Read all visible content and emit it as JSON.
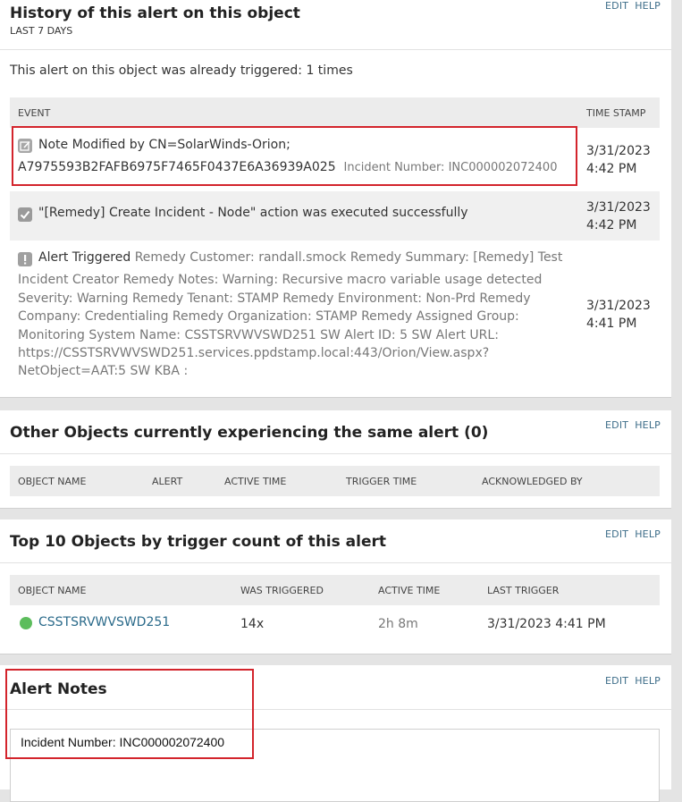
{
  "common": {
    "edit_label": "EDIT",
    "help_label": "HELP"
  },
  "history": {
    "title": "History of this alert on this object",
    "subtitle": "LAST 7 DAYS",
    "summary": "This alert on this object was already triggered: 1 times",
    "col_event": "EVENT",
    "col_timestamp": "TIME STAMP",
    "events": [
      {
        "icon": "note-edit-icon",
        "line1": "Note Modified by CN=SolarWinds-Orion;",
        "line2": "A7975593B2FAFB6975F7465F0437E6A36939A025",
        "detail": "Incident Number: INC000002072400",
        "date": "3/31/2023",
        "time": "4:42 PM"
      },
      {
        "icon": "check-icon",
        "text": "\"[Remedy] Create Incident - Node\" action was executed successfully",
        "date": "3/31/2023",
        "time": "4:42 PM"
      },
      {
        "icon": "exclamation-icon",
        "label": "Alert Triggered",
        "detail_first": "Remedy Customer: randall.smock Remedy Summary: [Remedy] Test",
        "detail_lines": [
          "Incident Creator Remedy Notes: Warning: Recursive macro variable usage detected",
          "Severity: Warning Remedy Tenant: STAMP Remedy Environment: Non-Prd Remedy",
          "Company: Credentialing Remedy Organization: STAMP Remedy Assigned Group:",
          "Monitoring System Name: CSSTSRVWVSWD251 SW Alert ID: 5 SW Alert URL:",
          "https://CSSTSRVWVSWD251.services.ppdstamp.local:443/Orion/View.aspx?",
          "NetObject=AAT:5 SW KBA :"
        ],
        "date": "3/31/2023",
        "time": "4:41 PM"
      }
    ]
  },
  "other_objects": {
    "title": "Other Objects currently experiencing the same alert (0)",
    "columns": [
      "OBJECT NAME",
      "ALERT",
      "ACTIVE TIME",
      "TRIGGER TIME",
      "ACKNOWLEDGED BY"
    ]
  },
  "top10": {
    "title": "Top 10 Objects by trigger count of this alert",
    "columns": [
      "OBJECT NAME",
      "WAS TRIGGERED",
      "ACTIVE TIME",
      "LAST TRIGGER"
    ],
    "rows": [
      {
        "status": "up",
        "status_color": "#5cbd5c",
        "name": "CSSTSRVWVSWD251",
        "triggered": "14x",
        "active_time": "2h 8m",
        "last_trigger": "3/31/2023 4:41 PM"
      }
    ]
  },
  "notes": {
    "title": "Alert Notes",
    "value": "Incident Number: INC000002072400"
  },
  "colors": {
    "highlight": "#d3242c",
    "link": "#2a6a8a",
    "status_up": "#5cbd5c"
  }
}
